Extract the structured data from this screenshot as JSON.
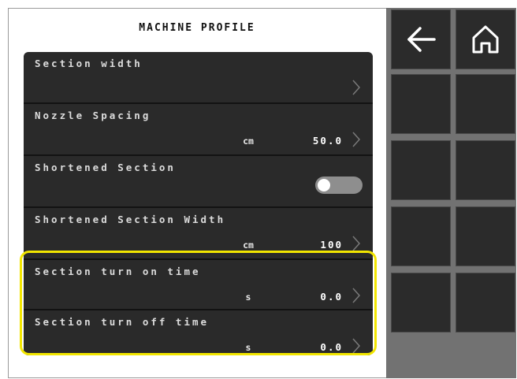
{
  "header": {
    "title": "MACHINE PROFILE"
  },
  "rows": [
    {
      "label": "Section width",
      "unit": "",
      "value": ""
    },
    {
      "label": "Nozzle Spacing",
      "unit": "cm",
      "value": "50.0"
    },
    {
      "label": "Shortened Section",
      "toggle": "off"
    },
    {
      "label": "Shortened Section Width",
      "unit": "cm",
      "value": "100"
    },
    {
      "label": "Section turn on time",
      "unit": "s",
      "value": "0.0"
    },
    {
      "label": "Section turn off time",
      "unit": "s",
      "value": "0.0"
    }
  ],
  "toolbar": {
    "back_icon": "arrow-left-icon",
    "home_icon": "home-icon"
  },
  "colors": {
    "panel": "#2a2a2a",
    "highlight": "#f2e600",
    "sidebar": "#727272",
    "tile": "#2b2b2b"
  }
}
